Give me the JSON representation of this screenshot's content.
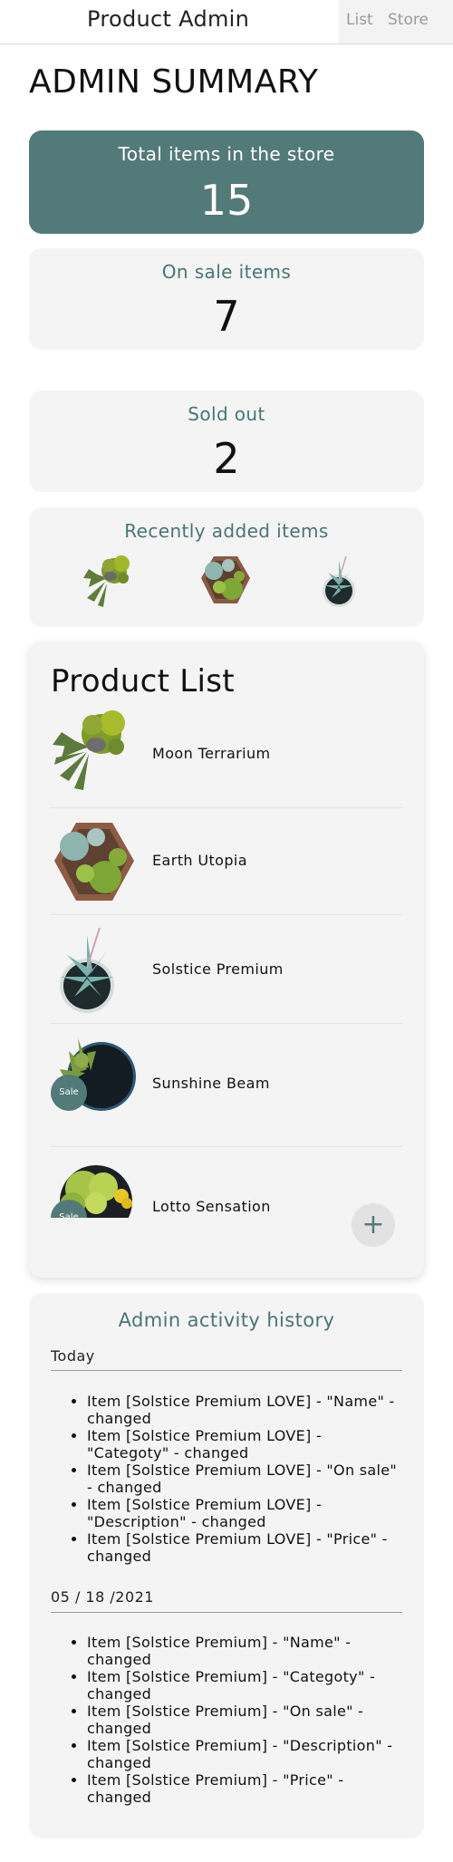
{
  "header": {
    "title": "Product Admin",
    "nav": {
      "list_label": "List",
      "store_label": "Store"
    }
  },
  "summary": {
    "heading": "ADMIN SUMMARY",
    "total": {
      "label": "Total items in the store",
      "value": "15"
    },
    "on_sale": {
      "label": "On sale items",
      "value": "7"
    },
    "sold_out": {
      "label": "Sold out",
      "value": "2"
    },
    "recent": {
      "label": "Recently added items",
      "items": [
        "Moon Terrarium",
        "Earth Utopia",
        "Solstice Premium"
      ]
    }
  },
  "product_list": {
    "title": "Product List",
    "items": [
      {
        "name": "Moon Terrarium",
        "sale": false
      },
      {
        "name": "Earth Utopia",
        "sale": false
      },
      {
        "name": "Solstice Premium",
        "sale": false
      },
      {
        "name": "Sunshine Beam",
        "sale": true
      },
      {
        "name": "Lotto Sensation",
        "sale": true
      }
    ],
    "sale_badge_label": "Sale",
    "add_label": "+"
  },
  "activity": {
    "title": "Admin activity history",
    "groups": [
      {
        "date": "Today",
        "entries": [
          "Item [Solstice Premium LOVE] - \"Name\" - changed",
          "Item [Solstice Premium LOVE] - \"Categoty\" - changed",
          "Item [Solstice Premium LOVE] - \"On sale\" - changed",
          "Item [Solstice Premium LOVE] - \"Description\" - changed",
          "Item [Solstice Premium LOVE] - \"Price\" - changed"
        ]
      },
      {
        "date": "05 / 18 /2021",
        "entries": [
          "Item [Solstice Premium] - \"Name\" - changed",
          "Item [Solstice Premium] - \"Categoty\" - changed",
          "Item [Solstice Premium] - \"On sale\" - changed",
          "Item [Solstice Premium] - \"Description\" - changed",
          "Item [Solstice Premium] - \"Price\" - changed"
        ]
      }
    ]
  },
  "colors": {
    "accent": "#527a79",
    "accent_text": "#4a7474",
    "card_bg": "#f4f4f4"
  }
}
